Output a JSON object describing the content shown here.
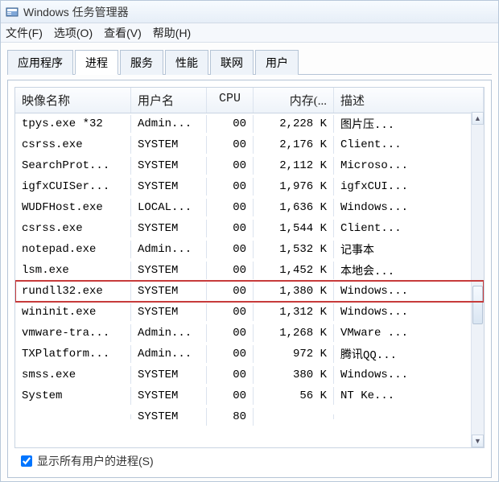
{
  "window": {
    "title": "Windows 任务管理器"
  },
  "menu": {
    "file": "文件(F)",
    "options": "选项(O)",
    "view": "查看(V)",
    "help": "帮助(H)"
  },
  "tabs": {
    "apps": "应用程序",
    "processes": "进程",
    "services": "服务",
    "performance": "性能",
    "networking": "联网",
    "users": "用户"
  },
  "columns": {
    "image_name": "映像名称",
    "user_name": "用户名",
    "cpu": "CPU",
    "memory": "内存(...",
    "description": "描述"
  },
  "rows": [
    {
      "name": "tpys.exe *32",
      "user": "Admin...",
      "cpu": "00",
      "mem": "2,228 K",
      "desc": "图片压..."
    },
    {
      "name": "csrss.exe",
      "user": "SYSTEM",
      "cpu": "00",
      "mem": "2,176 K",
      "desc": "Client..."
    },
    {
      "name": "SearchProt...",
      "user": "SYSTEM",
      "cpu": "00",
      "mem": "2,112 K",
      "desc": "Microso..."
    },
    {
      "name": "igfxCUISer...",
      "user": "SYSTEM",
      "cpu": "00",
      "mem": "1,976 K",
      "desc": "igfxCUI..."
    },
    {
      "name": "WUDFHost.exe",
      "user": "LOCAL...",
      "cpu": "00",
      "mem": "1,636 K",
      "desc": "Windows..."
    },
    {
      "name": "csrss.exe",
      "user": "SYSTEM",
      "cpu": "00",
      "mem": "1,544 K",
      "desc": "Client..."
    },
    {
      "name": "notepad.exe",
      "user": "Admin...",
      "cpu": "00",
      "mem": "1,532 K",
      "desc": "记事本"
    },
    {
      "name": "lsm.exe",
      "user": "SYSTEM",
      "cpu": "00",
      "mem": "1,452 K",
      "desc": "本地会..."
    },
    {
      "name": "rundll32.exe",
      "user": "SYSTEM",
      "cpu": "00",
      "mem": "1,380 K",
      "desc": "Windows...",
      "highlight": true
    },
    {
      "name": "wininit.exe",
      "user": "SYSTEM",
      "cpu": "00",
      "mem": "1,312 K",
      "desc": "Windows..."
    },
    {
      "name": "vmware-tra...",
      "user": "Admin...",
      "cpu": "00",
      "mem": "1,268 K",
      "desc": "VMware ..."
    },
    {
      "name": "TXPlatform...",
      "user": "Admin...",
      "cpu": "00",
      "mem": "972 K",
      "desc": "腾讯QQ..."
    },
    {
      "name": "smss.exe",
      "user": "SYSTEM",
      "cpu": "00",
      "mem": "380 K",
      "desc": "Windows..."
    },
    {
      "name": "System",
      "user": "SYSTEM",
      "cpu": "00",
      "mem": "56 K",
      "desc": "NT Ke..."
    },
    {
      "name": "",
      "user": "SYSTEM",
      "cpu": "80",
      "mem": "",
      "desc": ""
    }
  ],
  "footer": {
    "show_all_users": "显示所有用户的进程(S)",
    "checked": true
  }
}
